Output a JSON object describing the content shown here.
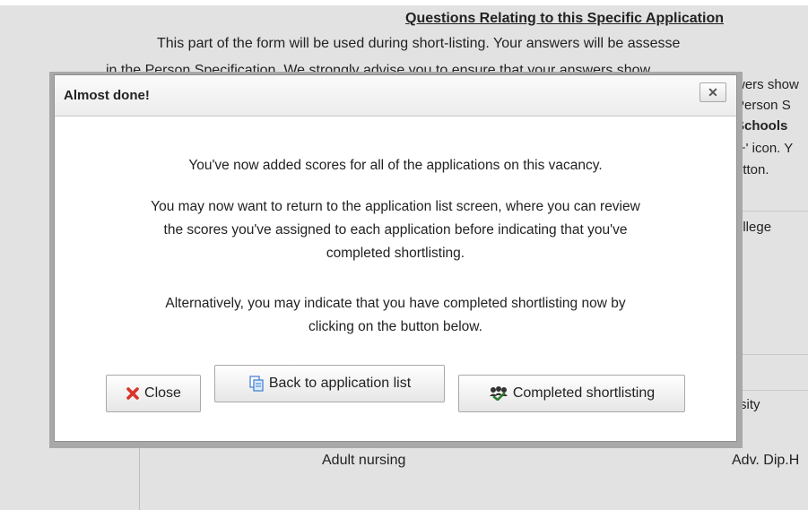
{
  "background": {
    "heading": "Questions Relating to this Specific Application",
    "intro_line1": "This part of the form will be used during short-listing. Your answers will be assesse",
    "intro_line2": "in the Person Specification. We strongly advise you to ensure that your answers show",
    "right_fragments": [
      "wers show",
      "Person S",
      "Schools",
      "'+' icon. Y",
      "utton.",
      "ollege",
      "rsity"
    ],
    "table_cells": {
      "subject": "Adult nursing",
      "qualification": "Adv. Dip.H"
    }
  },
  "dialog": {
    "title": "Almost done!",
    "close_x": "✕",
    "paragraph1": "You've now added scores for all of the applications on this vacancy.",
    "paragraph2_line1": "You may now want to return to the application list screen, where you can review",
    "paragraph2_line2": "the scores you've assigned to each application before indicating that you've",
    "paragraph2_line3": "completed shortlisting.",
    "paragraph3_line1": "Alternatively, you may indicate that you have completed shortlisting now by",
    "paragraph3_line2": "clicking on the button below.",
    "buttons": {
      "close": "Close",
      "back": "Back to application list",
      "completed": "Completed shortlisting"
    },
    "icons": {
      "close": "red-x-icon",
      "back": "documents-icon",
      "completed": "group-check-icon"
    }
  },
  "colors": {
    "close_icon": "#d9342b",
    "back_icon": "#3a7ad1",
    "completed_icon": "#2d7a2d"
  }
}
